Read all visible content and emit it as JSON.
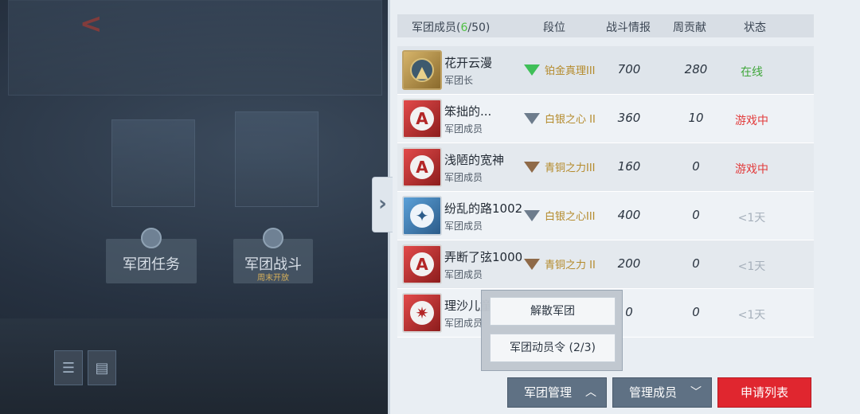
{
  "header": {
    "members_label": "军团成员",
    "members_count": "6",
    "members_max": "/50",
    "rank": "段位",
    "intel": "战斗情报",
    "contribution": "周贡献",
    "status": "状态"
  },
  "members": [
    {
      "name": "花开云漫",
      "role": "军团长",
      "rank": "铂金真理III",
      "intel": "700",
      "contribution": "280",
      "status": "在线"
    },
    {
      "name": "笨拙的...",
      "role": "军团成员",
      "rank": "白银之心 II",
      "intel": "360",
      "contribution": "10",
      "status": "游戏中"
    },
    {
      "name": "浅陋的宽神",
      "role": "军团成员",
      "rank": "青铜之力III",
      "intel": "160",
      "contribution": "0",
      "status": "游戏中"
    },
    {
      "name": "纷乱的路1002",
      "role": "军团成员",
      "rank": "白银之心III",
      "intel": "400",
      "contribution": "0",
      "status": "<1天"
    },
    {
      "name": "弄断了弦1000",
      "role": "军团成员",
      "rank": "青铜之力 II",
      "intel": "200",
      "contribution": "0",
      "status": "<1天"
    },
    {
      "name": "理沙儿童",
      "role": "军团成员",
      "rank": "",
      "intel": "0",
      "contribution": "0",
      "status": "<1天"
    }
  ],
  "popup": {
    "disband": "解散军团",
    "mobilize": "军团动员令 (2/3)"
  },
  "buttons": {
    "manage": "军团管理",
    "manage_members": "管理成员",
    "apply_list": "申请列表"
  },
  "background": {
    "task_card": "军团任务",
    "battle_card": "军团战斗",
    "battle_sub": "周末开放"
  },
  "icons": {
    "back": "back-arrow-icon",
    "panel_collapse": "chevron-right-icon",
    "list": "list-icon",
    "chat": "chat-icon"
  },
  "colors": {
    "online": "#3fa63a",
    "ingame": "#e23b3b",
    "apply_button": "#e0262f",
    "count_highlight": "#4fbf43"
  }
}
